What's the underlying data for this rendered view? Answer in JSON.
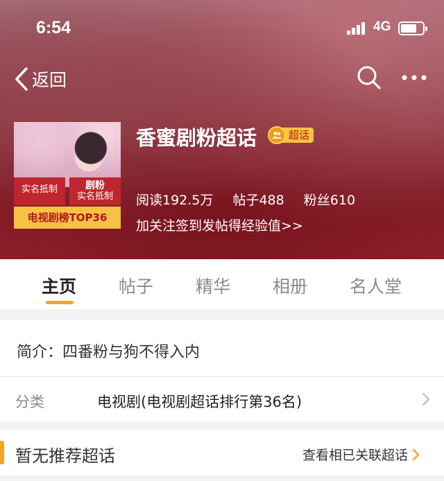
{
  "status_bar": {
    "time": "6:54",
    "network": "4G"
  },
  "nav": {
    "back_label": "返回",
    "search_icon": "search-icon",
    "more_icon": "more-icon"
  },
  "cover": {
    "tag_left": "实名抵制",
    "tag_right_title": "剧粉",
    "tag_right_sub": "实名抵制",
    "rank_strip": "电视剧榜TOP36"
  },
  "topic": {
    "title": "香蜜剧粉超话",
    "badge_label": "超话",
    "stats": {
      "reads": "阅读192.5万",
      "posts": "帖子488",
      "fans": "粉丝610"
    },
    "hint": "加关注签到发帖得经验值>>"
  },
  "tabs": [
    {
      "label": "主页"
    },
    {
      "label": "帖子"
    },
    {
      "label": "精华"
    },
    {
      "label": "相册"
    },
    {
      "label": "名人堂"
    }
  ],
  "intro": {
    "text": "简介：四番粉与狗不得入内"
  },
  "category": {
    "label": "分类",
    "value": "电视剧(电视剧超话排行第36名)"
  },
  "recommend": {
    "title": "暂无推荐超话",
    "link": "查看相已关联超话"
  },
  "colors": {
    "accent": "#f7a42b",
    "badge": "#f7c340",
    "badge_text": "#c9131d",
    "hero_dark": "#7f1a24"
  }
}
